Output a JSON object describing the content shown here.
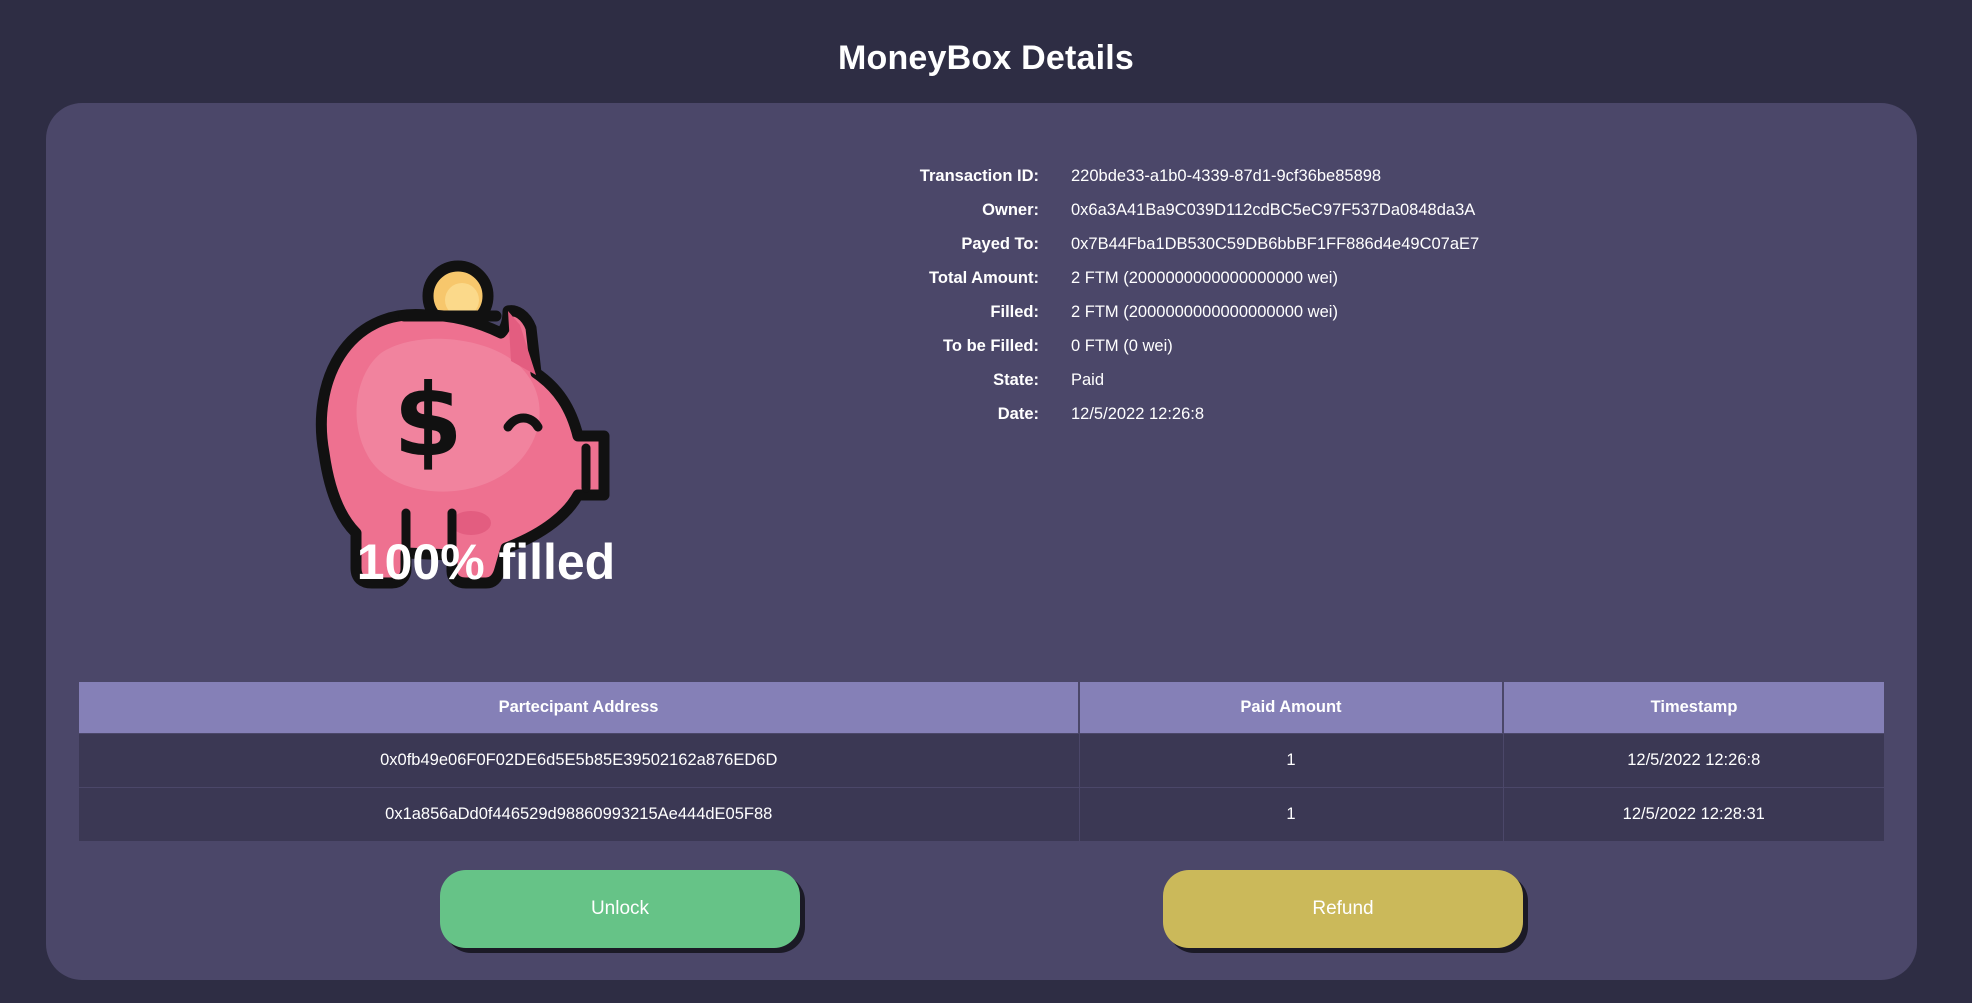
{
  "page": {
    "title": "MoneyBox Details"
  },
  "moneybox": {
    "percent_label": "100% filled",
    "fill_fraction": 1.0
  },
  "details": [
    {
      "label": "Transaction ID:",
      "value": "220bde33-a1b0-4339-87d1-9cf36be85898"
    },
    {
      "label": "Owner:",
      "value": "0x6a3A41Ba9C039D112cdBC5eC97F537Da0848da3A"
    },
    {
      "label": "Payed To:",
      "value": "0x7B44Fba1DB530C59DB6bbBF1FF886d4e49C07aE7"
    },
    {
      "label": "Total Amount:",
      "value": "2 FTM (2000000000000000000 wei)"
    },
    {
      "label": "Filled:",
      "value": "2 FTM (2000000000000000000 wei)"
    },
    {
      "label": "To be Filled:",
      "value": "0 FTM (0 wei)"
    },
    {
      "label": "State:",
      "value": "Paid"
    },
    {
      "label": "Date:",
      "value": "12/5/2022 12:26:8"
    }
  ],
  "table": {
    "headers": [
      "Partecipant Address",
      "Paid Amount",
      "Timestamp"
    ],
    "rows": [
      [
        "0x0fb49e06F0F02DE6d5E5b85E39502162a876ED6D",
        "1",
        "12/5/2022 12:26:8"
      ],
      [
        "0x1a856aDd0f446529d98860993215Ae444dE05F88",
        "1",
        "12/5/2022 12:28:31"
      ]
    ]
  },
  "buttons": {
    "unlock_label": "Unlock",
    "refund_label": "Refund"
  },
  "colors": {
    "background": "#2e2d44",
    "card": "#4b4769",
    "table_header": "#8580b7",
    "table_row": "#3b3854",
    "unlock": "#66c387",
    "refund": "#cbb95a",
    "pig": "#ee7190",
    "coin": "#f7c76c"
  },
  "icons": {
    "moneybox": "piggy-bank-icon"
  }
}
